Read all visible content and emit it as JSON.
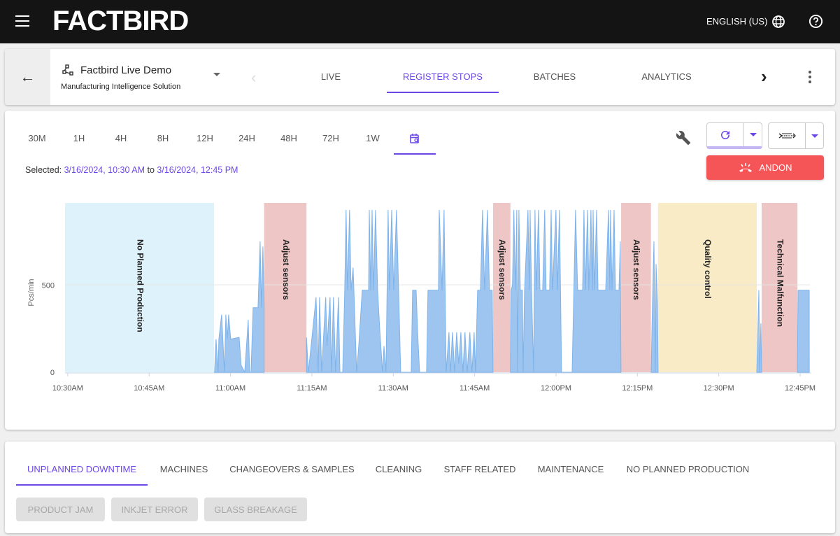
{
  "header": {
    "logo": "FACTBIRD",
    "language": "ENGLISH (US)",
    "icons": [
      "menu-icon",
      "globe-icon",
      "help-icon"
    ]
  },
  "nav": {
    "site_title": "Factbird Live Demo",
    "site_subtitle": "Manufacturing Intelligence Solution",
    "tabs": [
      {
        "label": "LIVE"
      },
      {
        "label": "REGISTER STOPS",
        "active": true
      },
      {
        "label": "BATCHES"
      },
      {
        "label": "ANALYTICS"
      }
    ]
  },
  "toolbar": {
    "ranges": [
      "30M",
      "1H",
      "4H",
      "8H",
      "12H",
      "24H",
      "48H",
      "72H",
      "1W"
    ],
    "active_range": "custom-calendar",
    "selected_label": "Selected:",
    "from": "3/16/2024, 10:30 AM",
    "to_word": "to",
    "to": "3/16/2024, 12:45 PM",
    "andon_label": "ANDON"
  },
  "colors": {
    "accent": "#6c47e8",
    "andon": "#f55557",
    "area": "#9ec5ef",
    "area_line": "#7db3ea",
    "npp_band": "#def2fb",
    "stop_band": "#efc6c6",
    "quality_band": "#f9ebc6"
  },
  "chart_data": {
    "type": "area",
    "ylabel": "Pcs/min",
    "yticks": [
      0,
      500
    ],
    "ylim": [
      0,
      970
    ],
    "xlim": [
      "10:29:30",
      "12:46:48"
    ],
    "xticks": [
      {
        "t": "10:30:00",
        "label": "10:30AM"
      },
      {
        "t": "10:45:00",
        "label": "10:45AM"
      },
      {
        "t": "11:00:00",
        "label": "11:00AM"
      },
      {
        "t": "11:15:00",
        "label": "11:15AM"
      },
      {
        "t": "11:30:00",
        "label": "11:30AM"
      },
      {
        "t": "11:45:00",
        "label": "11:45AM"
      },
      {
        "t": "12:00:00",
        "label": "12:00PM"
      },
      {
        "t": "12:15:00",
        "label": "12:15PM"
      },
      {
        "t": "12:30:00",
        "label": "12:30PM"
      },
      {
        "t": "12:45:00",
        "label": "12:45PM"
      }
    ],
    "grid": "horizontal",
    "bands": [
      {
        "label": "No Planned Production",
        "start": "10:29:30",
        "end": "10:56:57",
        "kind": "npp"
      },
      {
        "label": "Adjust sensors",
        "start": "11:06:12",
        "end": "11:14:00",
        "kind": "stop"
      },
      {
        "label": "Adjust sensors",
        "start": "11:48:24",
        "end": "11:51:36",
        "kind": "stop"
      },
      {
        "label": "Adjust sensors",
        "start": "12:12:00",
        "end": "12:17:30",
        "kind": "stop"
      },
      {
        "label": "Quality control",
        "start": "12:18:48",
        "end": "12:37:00",
        "kind": "quality"
      },
      {
        "label": "Technical Malfunction",
        "start": "12:37:54",
        "end": "12:44:30",
        "kind": "stop"
      }
    ],
    "segments": [
      [
        [
          "10:56:57",
          0
        ],
        [
          "10:57:04",
          0
        ],
        [
          "10:57:20",
          190
        ],
        [
          "10:57:43",
          0
        ],
        [
          "10:57:51",
          190
        ],
        [
          "10:58:22",
          330
        ],
        [
          "10:58:53",
          0
        ],
        [
          "10:59:08",
          330
        ],
        [
          "10:59:24",
          190
        ],
        [
          "10:59:39",
          330
        ],
        [
          "11:00:02",
          190
        ],
        [
          "11:01:35",
          200
        ],
        [
          "11:01:58",
          40
        ],
        [
          "11:02:37",
          0
        ],
        [
          "11:03:16",
          300
        ],
        [
          "11:03:31",
          0
        ],
        [
          "11:03:47",
          0
        ],
        [
          "11:04:10",
          370
        ],
        [
          "11:05:04",
          370
        ],
        [
          "11:05:27",
          750
        ],
        [
          "11:05:43",
          370
        ],
        [
          "11:05:58",
          720
        ],
        [
          "11:06:12",
          370
        ]
      ],
      [
        [
          "11:14:00",
          200
        ],
        [
          "11:14:21",
          0
        ],
        [
          "11:15:46",
          430
        ],
        [
          "11:16:09",
          0
        ],
        [
          "11:16:25",
          430
        ],
        [
          "11:16:48",
          0
        ],
        [
          "11:17:33",
          430
        ],
        [
          "11:17:47",
          150
        ],
        [
          "11:18:21",
          430
        ],
        [
          "11:18:36",
          0
        ],
        [
          "11:18:59",
          430
        ],
        [
          "11:19:22",
          0
        ],
        [
          "11:19:54",
          430
        ],
        [
          "11:20:10",
          0
        ],
        [
          "11:20:41",
          0
        ],
        [
          "11:21:03",
          470
        ],
        [
          "11:21:18",
          930
        ],
        [
          "11:21:34",
          470
        ],
        [
          "11:21:57",
          930
        ],
        [
          "11:22:13",
          470
        ],
        [
          "11:22:36",
          600
        ],
        [
          "11:23:15",
          0
        ],
        [
          "11:23:38",
          150
        ],
        [
          "11:24:17",
          470
        ],
        [
          "11:25:27",
          470
        ],
        [
          "11:25:35",
          930
        ],
        [
          "11:25:50",
          470
        ],
        [
          "11:26:06",
          930
        ],
        [
          "11:26:21",
          470
        ],
        [
          "11:26:44",
          930
        ],
        [
          "11:27:07",
          470
        ],
        [
          "11:27:30",
          250
        ],
        [
          "11:28:01",
          0
        ],
        [
          "11:28:17",
          150
        ],
        [
          "11:28:40",
          0
        ],
        [
          "11:29:03",
          930
        ],
        [
          "11:29:18",
          470
        ],
        [
          "11:29:42",
          930
        ],
        [
          "11:30:05",
          470
        ],
        [
          "11:30:36",
          930
        ],
        [
          "11:30:59",
          470
        ],
        [
          "11:31:22",
          0
        ],
        [
          "11:33:18",
          0
        ],
        [
          "11:33:34",
          470
        ],
        [
          "11:34:13",
          470
        ],
        [
          "11:34:28",
          250
        ],
        [
          "11:34:51",
          0
        ],
        [
          "11:36:08",
          0
        ],
        [
          "11:36:24",
          470
        ],
        [
          "11:38:20",
          470
        ],
        [
          "11:38:28",
          930
        ],
        [
          "11:38:59",
          470
        ],
        [
          "11:39:22",
          930
        ],
        [
          "11:39:45",
          0
        ],
        [
          "11:40:16",
          230
        ],
        [
          "11:40:31",
          0
        ],
        [
          "11:40:55",
          230
        ],
        [
          "11:41:18",
          0
        ],
        [
          "11:41:41",
          230
        ],
        [
          "11:42:04",
          50
        ],
        [
          "11:42:27",
          230
        ],
        [
          "11:42:50",
          0
        ],
        [
          "11:43:13",
          230
        ],
        [
          "11:43:37",
          0
        ],
        [
          "11:44:07",
          230
        ],
        [
          "11:44:30",
          0
        ],
        [
          "11:44:54",
          230
        ],
        [
          "11:45:09",
          0
        ],
        [
          "11:45:33",
          470
        ],
        [
          "11:46:04",
          470
        ],
        [
          "11:46:27",
          930
        ],
        [
          "11:46:50",
          470
        ],
        [
          "11:47:21",
          930
        ],
        [
          "11:47:44",
          470
        ],
        [
          "11:48:15",
          470
        ],
        [
          "11:48:23",
          0
        ]
      ],
      [
        [
          "11:51:36",
          0
        ],
        [
          "11:51:44",
          470
        ],
        [
          "11:51:58",
          500
        ],
        [
          "11:52:14",
          930
        ],
        [
          "11:52:31",
          470
        ],
        [
          "11:52:46",
          930
        ],
        [
          "11:52:54",
          0
        ],
        [
          "11:53:09",
          930
        ],
        [
          "11:53:25",
          470
        ],
        [
          "11:53:48",
          470
        ],
        [
          "11:53:56",
          0
        ],
        [
          "11:54:12",
          470
        ],
        [
          "11:54:50",
          930
        ],
        [
          "11:55:05",
          470
        ],
        [
          "11:55:13",
          930
        ],
        [
          "11:55:29",
          470
        ],
        [
          "11:55:52",
          0
        ],
        [
          "11:56:07",
          930
        ],
        [
          "11:56:22",
          470
        ],
        [
          "11:56:46",
          930
        ],
        [
          "11:57:02",
          470
        ],
        [
          "11:57:32",
          470
        ],
        [
          "11:57:55",
          930
        ],
        [
          "11:58:10",
          470
        ],
        [
          "11:58:49",
          470
        ],
        [
          "11:59:06",
          930
        ],
        [
          "11:59:21",
          470
        ],
        [
          "11:59:59",
          930
        ],
        [
          "12:00:15",
          470
        ],
        [
          "12:00:38",
          930
        ],
        [
          "12:01:01",
          0
        ],
        [
          "12:02:58",
          0
        ],
        [
          "12:03:36",
          930
        ],
        [
          "12:03:59",
          470
        ],
        [
          "12:04:54",
          470
        ],
        [
          "12:05:09",
          930
        ],
        [
          "12:05:25",
          470
        ],
        [
          "12:05:48",
          930
        ],
        [
          "12:06:03",
          470
        ],
        [
          "12:06:26",
          930
        ],
        [
          "12:06:42",
          470
        ],
        [
          "12:06:50",
          930
        ],
        [
          "12:07:05",
          470
        ],
        [
          "12:07:29",
          930
        ],
        [
          "12:07:44",
          470
        ],
        [
          "12:09:09",
          470
        ],
        [
          "12:09:40",
          930
        ],
        [
          "12:09:55",
          470
        ],
        [
          "12:10:03",
          930
        ],
        [
          "12:10:19",
          470
        ],
        [
          "12:10:42",
          930
        ],
        [
          "12:10:57",
          470
        ],
        [
          "12:11:36",
          470
        ],
        [
          "12:11:51",
          750
        ],
        [
          "12:11:59",
          0
        ]
      ],
      [
        [
          "12:17:32",
          0
        ],
        [
          "12:17:47",
          400
        ],
        [
          "12:18:03",
          750
        ],
        [
          "12:18:18",
          0
        ],
        [
          "12:18:26",
          620
        ],
        [
          "12:18:42",
          400
        ],
        [
          "12:18:49",
          0
        ]
      ],
      [
        [
          "12:37:00",
          0
        ],
        [
          "12:37:23",
          470
        ],
        [
          "12:37:31",
          0
        ],
        [
          "12:37:46",
          280
        ],
        [
          "12:37:54",
          0
        ]
      ],
      [
        [
          "12:44:29",
          0
        ],
        [
          "12:44:37",
          470
        ],
        [
          "12:46:40",
          470
        ],
        [
          "12:46:41",
          0
        ]
      ]
    ]
  },
  "bottom": {
    "tabs": [
      {
        "label": "UNPLANNED DOWNTIME",
        "active": true
      },
      {
        "label": "MACHINES"
      },
      {
        "label": "CHANGEOVERS & SAMPLES"
      },
      {
        "label": "CLEANING"
      },
      {
        "label": "STAFF RELATED"
      },
      {
        "label": "MAINTENANCE"
      },
      {
        "label": "NO PLANNED PRODUCTION"
      }
    ],
    "chips": [
      "PRODUCT JAM",
      "INKJET ERROR",
      "GLASS BREAKAGE"
    ]
  }
}
